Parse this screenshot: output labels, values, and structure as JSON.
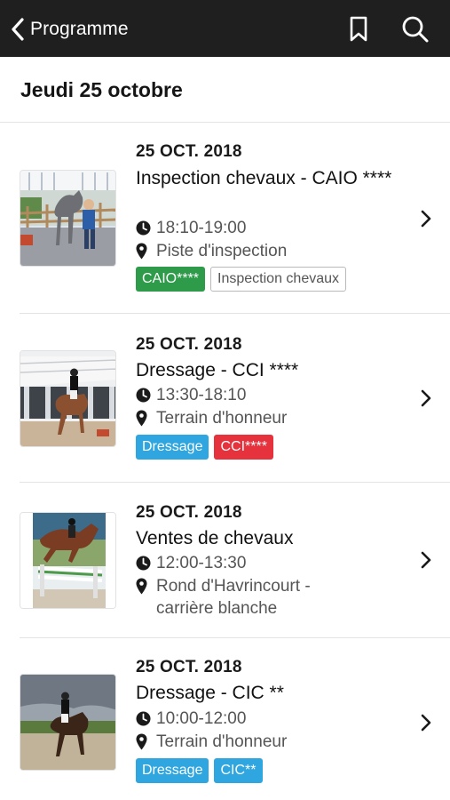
{
  "nav": {
    "back_label": "Programme",
    "icons": [
      "back-chevron-icon",
      "bookmark-icon",
      "search-icon"
    ],
    "bg_color": "#1f1f1f"
  },
  "date_header": {
    "title": "Jeudi 25 octobre"
  },
  "events": [
    {
      "date": "25 OCT. 2018",
      "title": "Inspection chevaux - CAIO ****",
      "time": "18:10-19:00",
      "location": "Piste d'inspection",
      "tags": [
        {
          "label": "CAIO****",
          "color": "#2e9b4a",
          "style": "filled"
        },
        {
          "label": "Inspection chevaux",
          "color": "#ffffff",
          "style": "outline"
        }
      ],
      "image": "horse-inspection-photo"
    },
    {
      "date": "25 OCT. 2018",
      "title": "Dressage - CCI ****",
      "time": "13:30-18:10",
      "location": "Terrain d'honneur",
      "tags": [
        {
          "label": "Dressage",
          "color": "#2fa6df",
          "style": "filled"
        },
        {
          "label": "CCI****",
          "color": "#e5323d",
          "style": "filled"
        }
      ],
      "image": "dressage-arena-photo"
    },
    {
      "date": "25 OCT. 2018",
      "title": "Ventes de chevaux",
      "time": "12:00-13:30",
      "location": "Rond d'Havrincourt - carrière blanche",
      "tags": [],
      "image": "show-jumping-photo"
    },
    {
      "date": "25 OCT. 2018",
      "title": "Dressage - CIC **",
      "time": "10:00-12:00",
      "location": "Terrain d'honneur",
      "tags": [
        {
          "label": "Dressage",
          "color": "#2fa6df",
          "style": "filled"
        },
        {
          "label": "CIC**",
          "color": "#2fa6df",
          "style": "filled"
        }
      ],
      "image": "dressage-outdoor-photo"
    }
  ]
}
